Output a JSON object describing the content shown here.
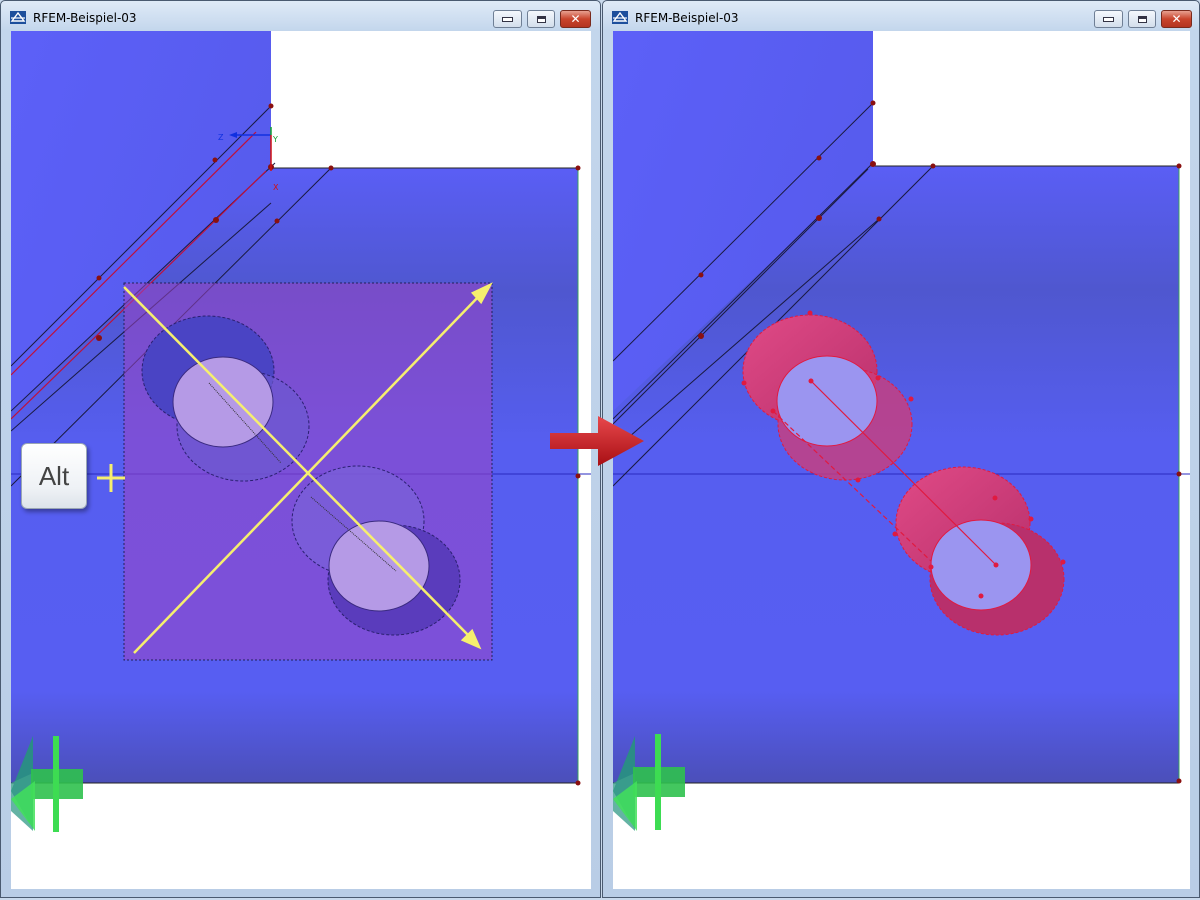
{
  "windows": {
    "left": {
      "title": "RFEM-Beispiel-03"
    },
    "right": {
      "title": "RFEM-Beispiel-03"
    }
  },
  "axes": {
    "z_label": "Z",
    "y_label": "Y",
    "x_label": "X"
  },
  "keyboard_hint": {
    "key_label": "Alt",
    "modifier_symbol": "+"
  },
  "colors": {
    "model_surface": "#5a5ef5",
    "selection_window": "#7a4fd6",
    "selected_member": "#d03070",
    "selection_diagonal": "#f6ef6e",
    "transition_arrow": "#c8161c",
    "view_cube_arrows": "#3ddc52"
  },
  "icons": {
    "app": "rfem-app-icon",
    "minimize": "minimize-icon",
    "maximize": "maximize-icon",
    "close": "close-icon",
    "result": "arrow-right-icon"
  }
}
